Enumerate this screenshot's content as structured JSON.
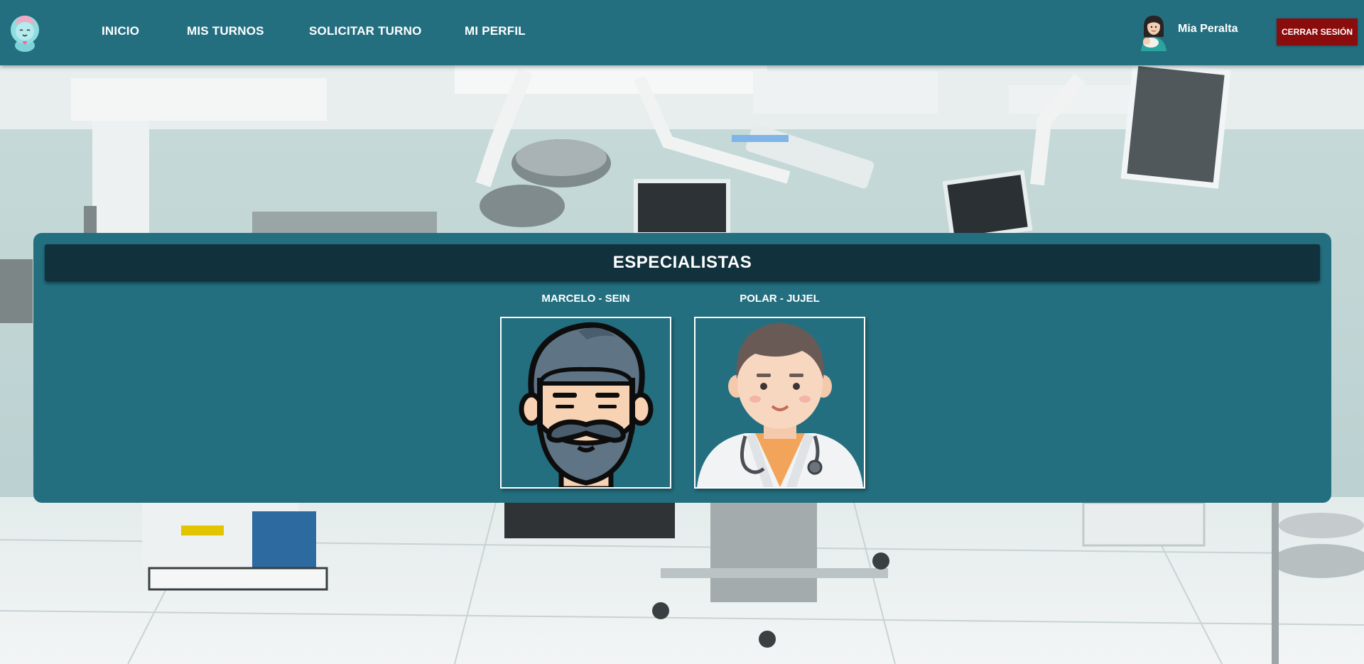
{
  "nav": {
    "logo_icon": "baby-brain-logo-icon",
    "links": [
      {
        "label": "INICIO"
      },
      {
        "label": "MIS TURNOS"
      },
      {
        "label": "SOLICITAR TURNO"
      },
      {
        "label": "MI PERFIL"
      }
    ],
    "user": {
      "avatar_icon": "woman-with-baby-avatar-icon",
      "name": "Mia Peralta"
    },
    "logout_label": "CERRAR SESIÓN"
  },
  "specialists": {
    "title": "ESPECIALISTAS",
    "items": [
      {
        "name": "MARCELO - SEIN",
        "avatar_icon": "bearded-man-avatar-icon"
      },
      {
        "name": "POLAR - JUJEL",
        "avatar_icon": "doctor-avatar-icon"
      }
    ]
  },
  "colors": {
    "primary": "#236f80",
    "header_dark": "#11313c",
    "logout": "#8a0c0c",
    "text": "#ffffff"
  }
}
